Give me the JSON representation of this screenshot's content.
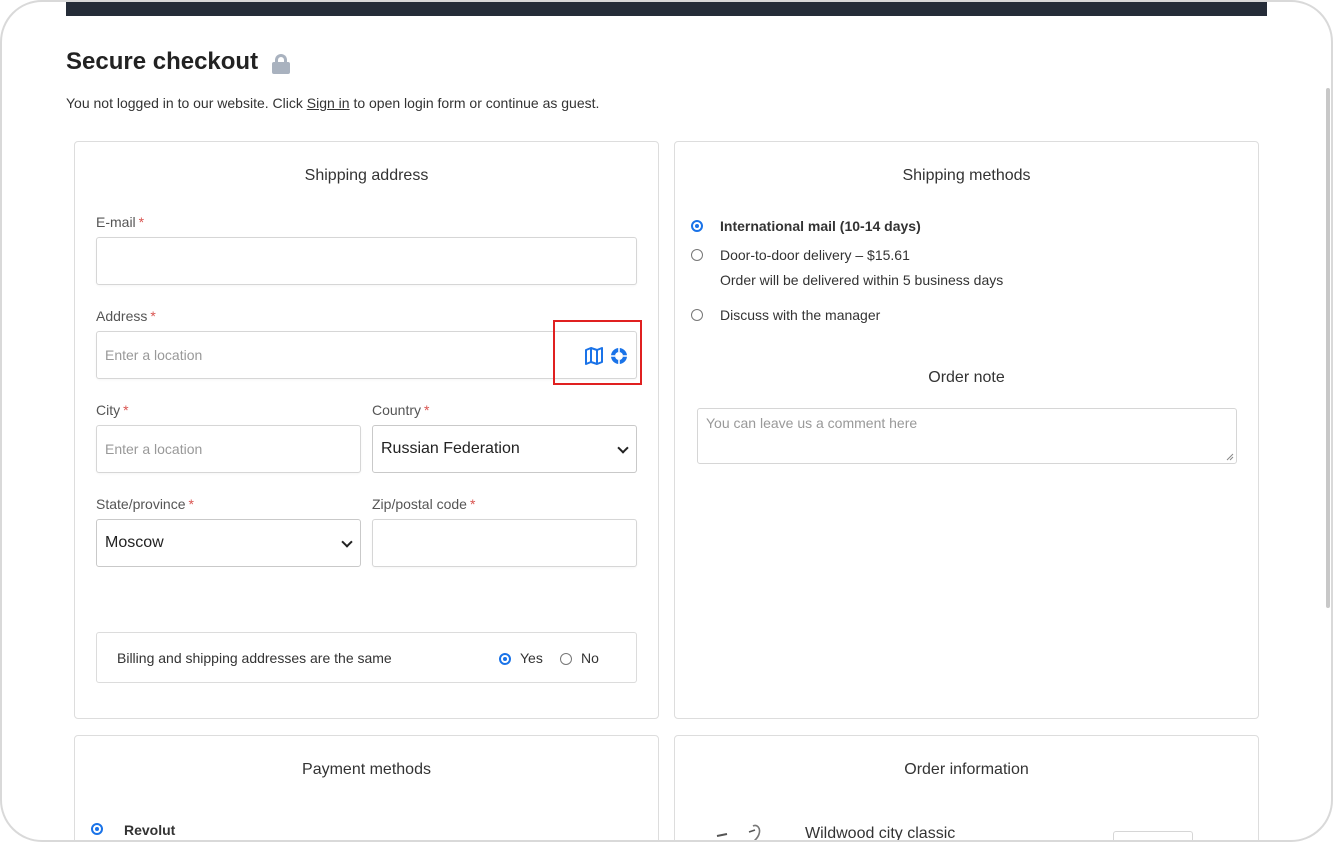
{
  "page": {
    "title": "Secure checkout",
    "login_note_prefix": "You not logged in to our website. Click ",
    "login_link": "Sign in",
    "login_note_suffix": " to open login form or continue as guest."
  },
  "shipping_address": {
    "title": "Shipping address",
    "email_label": "E-mail",
    "email_value": "",
    "address_label": "Address",
    "address_placeholder": "Enter a location",
    "city_label": "City",
    "city_placeholder": "Enter a location",
    "country_label": "Country",
    "country_value": "Russian Federation",
    "state_label": "State/province",
    "state_value": "Moscow",
    "zip_label": "Zip/postal code",
    "zip_value": "",
    "required_mark": "*",
    "billing_same_label": "Billing and shipping addresses are the same",
    "billing_yes": "Yes",
    "billing_no": "No",
    "billing_selected": "Yes"
  },
  "shipping_methods": {
    "title": "Shipping methods",
    "options": [
      {
        "label": "International mail (10-14 days)",
        "selected": true,
        "note": ""
      },
      {
        "label": "Door-to-door delivery – $15.61",
        "selected": false,
        "note": "Order will be delivered within 5 business days"
      },
      {
        "label": "Discuss with the manager",
        "selected": false,
        "note": ""
      }
    ]
  },
  "order_note": {
    "title": "Order note",
    "placeholder": "You can leave us a comment here"
  },
  "payment_methods": {
    "title": "Payment methods",
    "options": [
      {
        "label": "Revolut",
        "selected": true
      }
    ]
  },
  "order_information": {
    "title": "Order information",
    "items": [
      {
        "name": "Wildwood city classic",
        "image": "bicycle-image"
      }
    ]
  },
  "colors": {
    "accent": "#1a73e8",
    "topbar": "#252c38",
    "highlight": "#e02020",
    "required": "#d9534f"
  }
}
